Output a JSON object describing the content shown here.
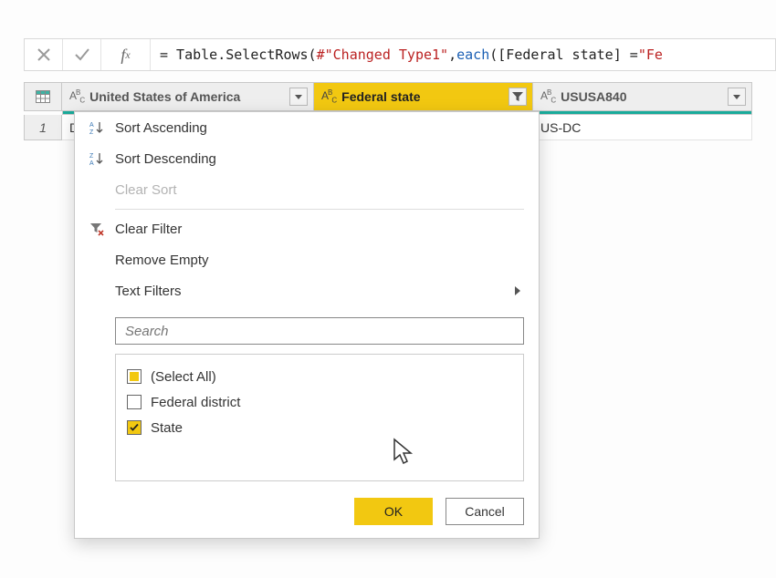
{
  "formula": {
    "prefix": "= Table.SelectRows(",
    "arg_str": "#\"Changed Type1\"",
    "comma": ", ",
    "each_kw": "each",
    "expr_open": " ([Federal state] = ",
    "tail_str": "\"Fe"
  },
  "columns": [
    {
      "label": "United States of America",
      "active": false
    },
    {
      "label": "Federal state",
      "active": true,
      "filtered": true
    },
    {
      "label": "USUSA840",
      "active": false
    }
  ],
  "rows": [
    {
      "num": "1",
      "cells": [
        "D",
        "",
        "US-DC"
      ]
    }
  ],
  "menu": {
    "sort_asc": "Sort Ascending",
    "sort_desc": "Sort Descending",
    "clear_sort": "Clear Sort",
    "clear_filter": "Clear Filter",
    "remove_empty": "Remove Empty",
    "text_filters": "Text Filters",
    "search_placeholder": "Search",
    "options": [
      {
        "label": "(Select All)",
        "state": "partial"
      },
      {
        "label": "Federal district",
        "state": "unchecked"
      },
      {
        "label": "State",
        "state": "checked"
      }
    ],
    "ok": "OK",
    "cancel": "Cancel"
  }
}
